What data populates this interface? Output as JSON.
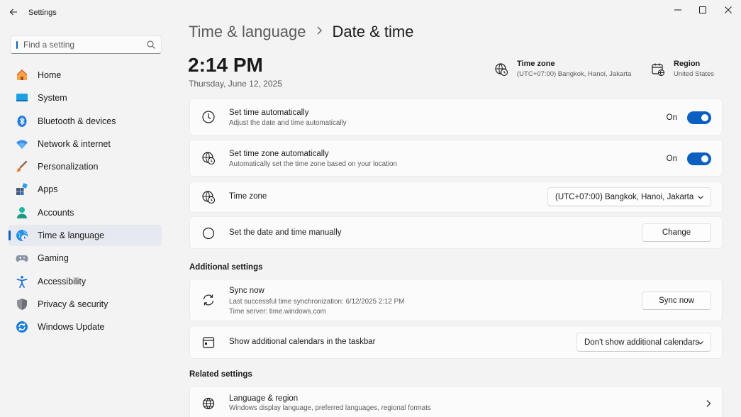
{
  "window": {
    "title": "Settings",
    "controls": [
      "minimize",
      "maximize",
      "close"
    ]
  },
  "search": {
    "placeholder": "Find a setting"
  },
  "sidebar": {
    "items": [
      {
        "label": "Home",
        "icon": "home-icon"
      },
      {
        "label": "System",
        "icon": "system-icon"
      },
      {
        "label": "Bluetooth & devices",
        "icon": "bluetooth-icon"
      },
      {
        "label": "Network & internet",
        "icon": "wifi-icon"
      },
      {
        "label": "Personalization",
        "icon": "brush-icon"
      },
      {
        "label": "Apps",
        "icon": "apps-icon"
      },
      {
        "label": "Accounts",
        "icon": "accounts-icon"
      },
      {
        "label": "Time & language",
        "icon": "globe-clock-icon",
        "active": true
      },
      {
        "label": "Gaming",
        "icon": "gamepad-icon"
      },
      {
        "label": "Accessibility",
        "icon": "accessibility-icon"
      },
      {
        "label": "Privacy & security",
        "icon": "shield-icon"
      },
      {
        "label": "Windows Update",
        "icon": "update-icon"
      }
    ]
  },
  "breadcrumb": {
    "parent": "Time & language",
    "current": "Date & time"
  },
  "clock": {
    "time": "2:14 PM",
    "date": "Thursday, June 12, 2025"
  },
  "info": {
    "timezone": {
      "title": "Time zone",
      "value": "(UTC+07:00) Bangkok, Hanoi, Jakarta"
    },
    "region": {
      "title": "Region",
      "value": "United States"
    }
  },
  "settings": {
    "set_time_auto": {
      "title": "Set time automatically",
      "desc": "Adjust the date and time automatically",
      "state": "On"
    },
    "set_tz_auto": {
      "title": "Set time zone automatically",
      "desc": "Automatically set the time zone based on your location",
      "state": "On"
    },
    "time_zone": {
      "title": "Time zone",
      "value": "(UTC+07:00) Bangkok, Hanoi, Jakarta"
    },
    "manual": {
      "title": "Set the date and time manually",
      "button": "Change"
    }
  },
  "additional": {
    "heading": "Additional settings",
    "sync": {
      "title": "Sync now",
      "last": "Last successful time synchronization: 6/12/2025 2:12 PM",
      "server": "Time server: time.windows.com",
      "button": "Sync now"
    },
    "calendars": {
      "title": "Show additional calendars in the taskbar",
      "value": "Don't show additional calendars"
    }
  },
  "related": {
    "heading": "Related settings",
    "language_region": {
      "title": "Language & region",
      "desc": "Windows display language, preferred languages, regional formats"
    }
  },
  "colors": {
    "accent": "#0a5fc1",
    "background": "#f3f3f3",
    "card": "#fbfbfb"
  }
}
